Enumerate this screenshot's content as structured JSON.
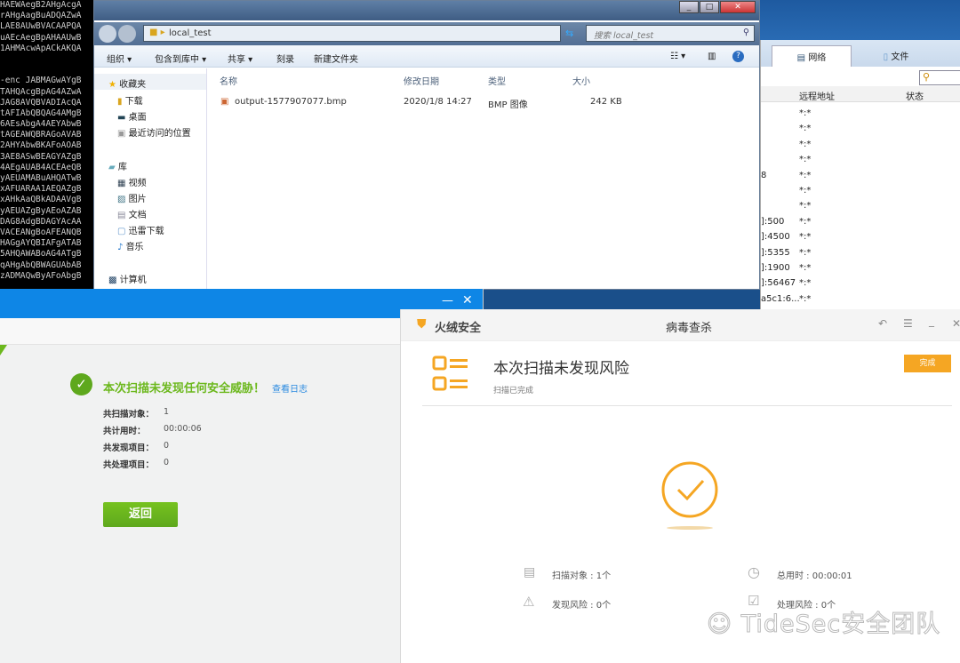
{
  "terminal": {
    "lines": [
      "HAEWAegB2AHgAcgA",
      "rAHgAagBuADQAZwA",
      "LAE8AUwBVACAAPQA",
      "uAEcAegBpAHAAUwB",
      "1AHMAcwApACkAKQA",
      "",
      "",
      "-enc JABMAGwAYgB",
      "TAHQAcgBpAG4AZwA",
      "JAG8AVQBVADIAcQA",
      "tAFIAbQBQAG4AMgB",
      "6AEsAbgA4AEYAbwB",
      "tAGEAWQBRAGoAVAB",
      "2AHYAbwBKAFoAOAB",
      "3AE8ASwBEAGYAZgB",
      "4AEgAUAB4ACEAeQB",
      "yAEUAMABuAHQATwB",
      "xAFUARAA1AEQAZgB",
      "xAHkAaQBkADAAVgB",
      "yAEUAZgByAEoAZAB",
      "DAG8AdgBDAGYAcAA",
      "VACEANgBoAFEANQB",
      "HAGgAYQBIAFgATAB",
      "5AHQAWABoAG4ATgB",
      "qAHgAbQBWAGUAbAB",
      "zADMAQwByAFoAbgB"
    ]
  },
  "network": {
    "tabs": [
      "网络",
      "文件"
    ],
    "headers": [
      "远程地址",
      "状态"
    ],
    "rows": [
      {
        "local": "",
        "remote": "*:*"
      },
      {
        "local": "",
        "remote": "*:*"
      },
      {
        "local": "",
        "remote": "*:*"
      },
      {
        "local": "",
        "remote": "*:*"
      },
      {
        "local": "8",
        "remote": "*:*"
      },
      {
        "local": "",
        "remote": "*:*"
      },
      {
        "local": "",
        "remote": "*:*"
      },
      {
        "local": "]:500",
        "remote": "*:*"
      },
      {
        "local": "]:4500",
        "remote": "*:*"
      },
      {
        "local": "]:5355",
        "remote": "*:*"
      },
      {
        "local": "]:1900",
        "remote": "*:*"
      },
      {
        "local": "]:56467",
        "remote": "*:*"
      },
      {
        "local": "a5c1:6...",
        "remote": "*:*"
      }
    ]
  },
  "explorer": {
    "path": "local_test",
    "search_placeholder": "搜索 local_test",
    "toolbar": [
      "组织 ▾",
      "包含到库中 ▾",
      "共享 ▾",
      "刻录",
      "新建文件夹"
    ],
    "sidebar": {
      "favorites": "收藏夹",
      "fav_items": [
        "下载",
        "桌面",
        "最近访问的位置"
      ],
      "library": "库",
      "lib_items": [
        "视频",
        "图片",
        "文档",
        "迅雷下载",
        "音乐"
      ],
      "computer": "计算机"
    },
    "columns": [
      "名称",
      "修改日期",
      "类型",
      "大小"
    ],
    "files": [
      {
        "name": "output-1577907077.bmp",
        "date": "2020/1/8 14:27",
        "type": "BMP 图像",
        "size": "242 KB"
      }
    ]
  },
  "q360": {
    "result": "本次扫描未发现任何安全威胁！",
    "log_link": "查看日志",
    "stats": [
      {
        "label": "共扫描对象：",
        "value": "1"
      },
      {
        "label": "共计用时：",
        "value": "00:00:06"
      },
      {
        "label": "共发现项目：",
        "value": "0"
      },
      {
        "label": "共处理项目：",
        "value": "0"
      }
    ],
    "back": "返回",
    "green": "#6cb81d",
    "blue": "#0e86e6"
  },
  "huorong": {
    "brand": "火绒安全",
    "window_title": "病毒查杀",
    "headline": "本次扫描未发现风险",
    "subtitle": "扫描已完成",
    "done": "完成",
    "accent": "#f5a623",
    "stats": [
      {
        "label": "扫描对象 : 1个",
        "icon": "document-icon"
      },
      {
        "label": "总用时 : 00:00:01",
        "icon": "clock-icon"
      },
      {
        "label": "发现风险 : 0个",
        "icon": "warning-icon"
      },
      {
        "label": "处理风险 : 0个",
        "icon": "checkbox-icon"
      }
    ]
  },
  "watermark": "TideSec安全团队"
}
